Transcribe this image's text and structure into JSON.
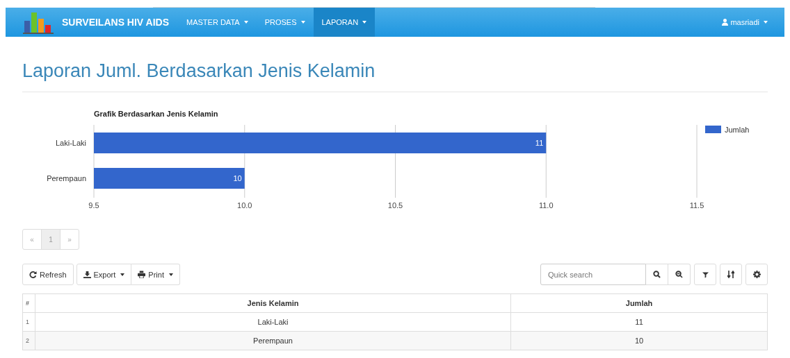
{
  "navbar": {
    "brand": "SURVEILANS HIV AIDS",
    "menus": [
      {
        "label": "MASTER DATA",
        "selected": false
      },
      {
        "label": "PROSES",
        "selected": false
      },
      {
        "label": "LAPORAN",
        "selected": true
      }
    ],
    "user": "masriadi"
  },
  "page_title": "Laporan Juml. Berdasarkan Jenis Kelamin",
  "chart": {
    "chart_data": {
      "type": "bar",
      "orientation": "horizontal",
      "title": "Grafik Berdasarkan Jenis Kelamin",
      "categories": [
        "Laki-Laki",
        "Perempaun"
      ],
      "series": [
        {
          "name": "Jumlah",
          "color": "#3366cc",
          "values": [
            11,
            10
          ]
        }
      ],
      "xlim": [
        9.5,
        11.5
      ],
      "xticks": [
        {
          "value": 9.5,
          "label": "9.5"
        },
        {
          "value": 10,
          "label": "10.0"
        },
        {
          "value": 10.5,
          "label": "10.5"
        },
        {
          "value": 11,
          "label": "11.0"
        },
        {
          "value": 11.5,
          "label": "11.5"
        }
      ],
      "data_labels": true,
      "grid": true
    }
  },
  "pagination": {
    "prev": "«",
    "pages": [
      {
        "label": "1",
        "selected": true
      }
    ],
    "next": "»"
  },
  "toolbar": {
    "buttons": [
      {
        "label": "Refresh",
        "kind": "refresh"
      },
      {
        "label": "Export",
        "kind": "export"
      },
      {
        "label": "Print",
        "kind": "print"
      }
    ],
    "search": {
      "placeholder": "Quick search"
    }
  },
  "table": {
    "columns": [
      "#",
      "Jenis Kelamin",
      "Jumlah"
    ],
    "rows": [
      [
        "1",
        "Laki-Laki",
        "11"
      ],
      [
        "2",
        "Perempaun",
        "10"
      ]
    ]
  }
}
